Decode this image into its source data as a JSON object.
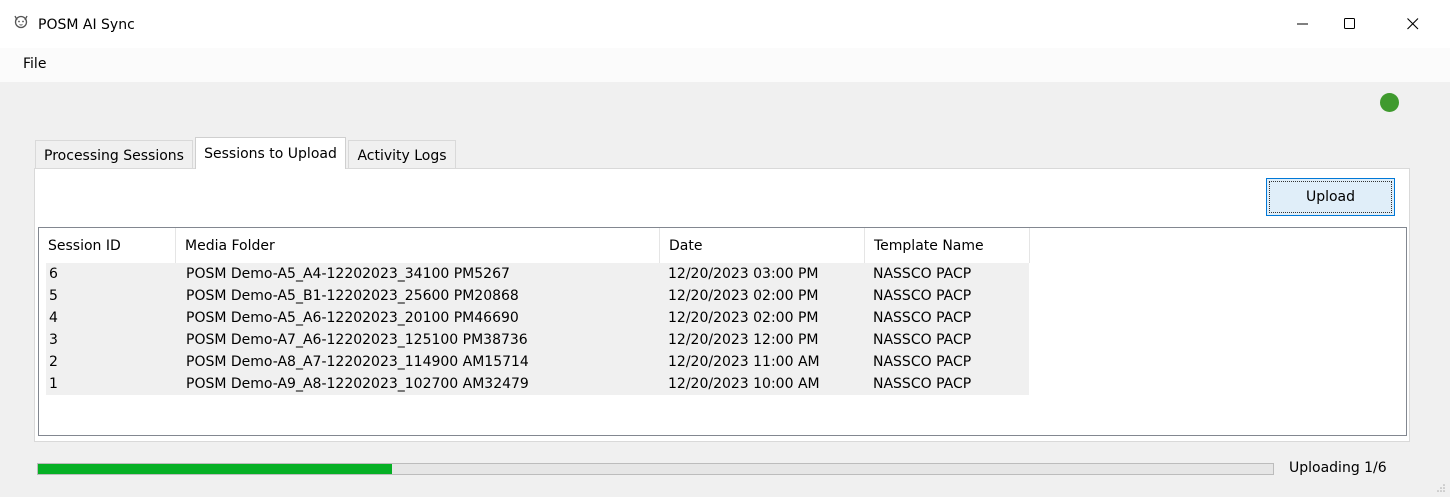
{
  "window": {
    "title": "POSM AI Sync",
    "icon": "cat-face-icon",
    "controls": [
      "minimize-icon",
      "maximize-icon",
      "close-icon"
    ]
  },
  "menu": {
    "file_label": "File"
  },
  "status": {
    "connected_color": "#3f9a2e"
  },
  "tabs": [
    {
      "label": "Processing Sessions",
      "active": false
    },
    {
      "label": "Sessions to Upload",
      "active": true
    },
    {
      "label": "Activity Logs",
      "active": false
    }
  ],
  "toolbar": {
    "upload_label": "Upload"
  },
  "table": {
    "columns": [
      "Session ID",
      "Media Folder",
      "Date",
      "Template Name"
    ],
    "rows": [
      [
        "6",
        "POSM Demo-A5_A4-12202023_34100 PM5267",
        "12/20/2023 03:00 PM",
        "NASSCO PACP"
      ],
      [
        "5",
        "POSM Demo-A5_B1-12202023_25600 PM20868",
        "12/20/2023 02:00 PM",
        "NASSCO PACP"
      ],
      [
        "4",
        "POSM Demo-A5_A6-12202023_20100 PM46690",
        "12/20/2023 02:00 PM",
        "NASSCO PACP"
      ],
      [
        "3",
        "POSM Demo-A7_A6-12202023_125100 PM38736",
        "12/20/2023 12:00 PM",
        "NASSCO PACP"
      ],
      [
        "2",
        "POSM Demo-A8_A7-12202023_114900 AM15714",
        "12/20/2023 11:00 AM",
        "NASSCO PACP"
      ],
      [
        "1",
        "POSM Demo-A9_A8-12202023_102700 AM32479",
        "12/20/2023 10:00 AM",
        "NASSCO PACP"
      ]
    ]
  },
  "progress": {
    "fraction": 0.287,
    "color": "#06b025",
    "text": "Uploading 1/6"
  }
}
